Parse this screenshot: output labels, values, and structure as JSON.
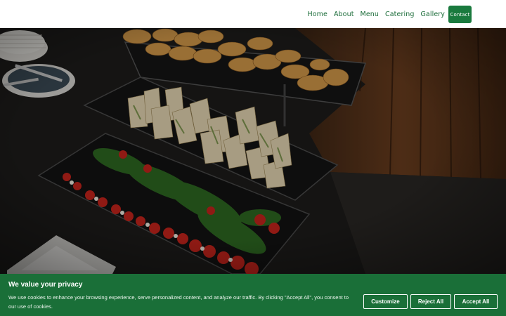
{
  "nav": {
    "items": [
      {
        "label": "Home"
      },
      {
        "label": "About"
      },
      {
        "label": "Menu"
      },
      {
        "label": "Catering"
      },
      {
        "label": "Gallery"
      }
    ],
    "contact_label": "Contact"
  },
  "colors": {
    "brand_green": "#1a7a3e",
    "banner_green": "#1a6f38",
    "nav_text": "#1a6b38"
  },
  "cookie": {
    "title": "We value your privacy",
    "text": "We use cookies to enhance your browsing experience, serve personalized content, and analyze our traffic. By clicking \"Accept All\", you consent to our use of cookies.",
    "customize_label": "Customize",
    "reject_label": "Reject All",
    "accept_label": "Accept All"
  }
}
